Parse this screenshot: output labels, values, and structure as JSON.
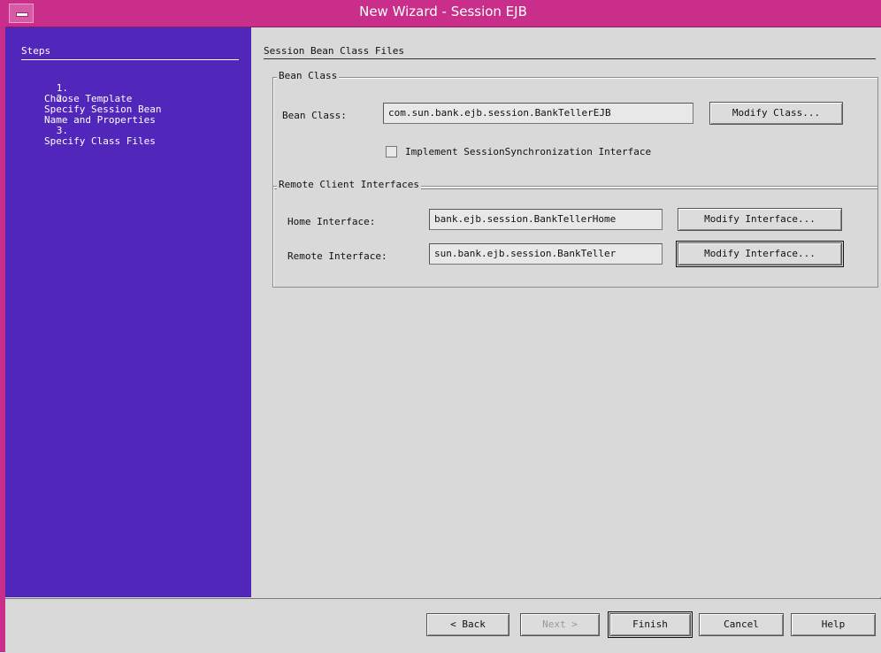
{
  "window": {
    "title": "New Wizard - Session EJB",
    "accent_color": "#c82e8a"
  },
  "steps": {
    "title": "Steps",
    "items": [
      {
        "number": "1.",
        "text": "Choose Template"
      },
      {
        "number": "2.",
        "text": "Specify Session Bean\nName and Properties"
      },
      {
        "number": "3.",
        "text": "Specify Class Files"
      }
    ],
    "background": "#5027ba"
  },
  "panel": {
    "title": "Session Bean Class Files",
    "bean_class_group": {
      "legend": "Bean Class",
      "label": "Bean Class:",
      "value": "com.sun.bank.ejb.session.BankTellerEJB",
      "button": "Modify Class...",
      "checkbox_label": "Implement SessionSynchronization Interface",
      "checked": false
    },
    "remote_group": {
      "legend": "Remote Client Interfaces",
      "home_label": "Home Interface:",
      "home_value": "bank.ejb.session.BankTellerHome",
      "home_button": "Modify Interface...",
      "remote_label": "Remote Interface:",
      "remote_value": "sun.bank.ejb.session.BankTeller",
      "remote_button": "Modify Interface..."
    }
  },
  "footer": {
    "back": "< Back",
    "next": "Next >",
    "finish": "Finish",
    "cancel": "Cancel",
    "help": "Help"
  }
}
